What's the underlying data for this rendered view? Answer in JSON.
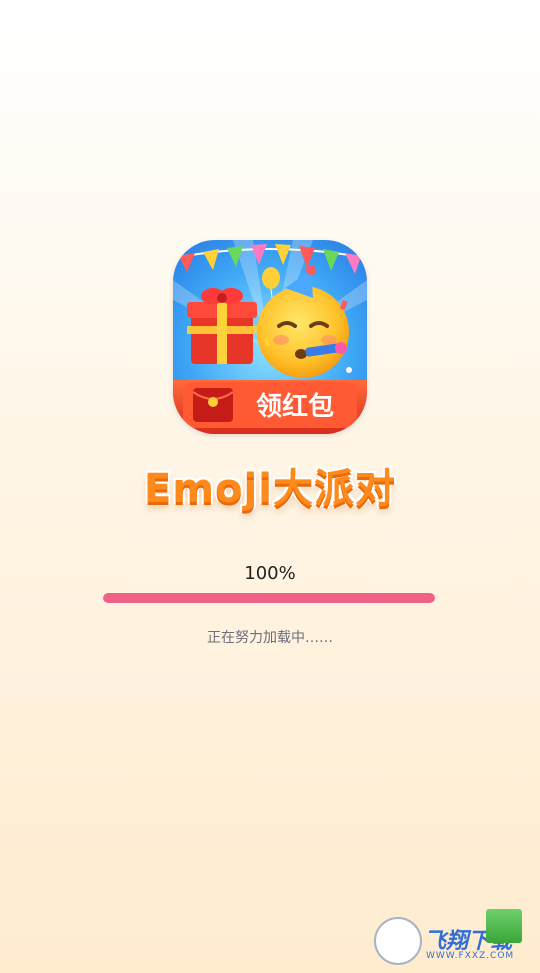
{
  "app": {
    "title": "Emoji大派对",
    "icon_name": "party-emoji-app-icon",
    "icon_banner_text": "领红包"
  },
  "loading": {
    "progress_label": "100%",
    "progress_value": 1.0,
    "status_text": "正在努力加载中……"
  },
  "watermark": {
    "name": "飞翔下载",
    "url": "WWW.FXXZ.COM"
  },
  "colors": {
    "progress_fill": "#f06188",
    "title": "#ff8a1c",
    "accent_red": "#e8402a"
  }
}
